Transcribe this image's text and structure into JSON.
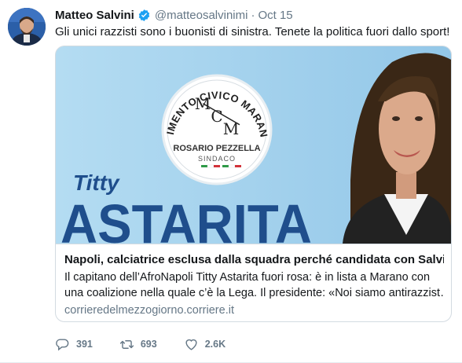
{
  "tweet": {
    "name": "Matteo Salvini",
    "handle": "@matteosalvinimi",
    "separator": "·",
    "date": "Oct 15",
    "text": "Gli unici razzisti sono i buonisti di sinistra. Tenete la politica fuori dallo sport!"
  },
  "card": {
    "image": {
      "logo_arc_text": "MOVIMENTO CIVICO MARANESE",
      "logo_letters": [
        "M",
        "C",
        "M"
      ],
      "logo_name": "ROSARIO PEZZELLA",
      "logo_role": "SINDACO",
      "first_name": "Titty",
      "last_name": "ASTARITA"
    },
    "title": "Napoli, calciatrice esclusa dalla squadra perché candidata con Salvini",
    "description_lines": [
      "Il capitano dell’AfroNapoli Titty Astarita fuori rosa: è in lista a Marano con",
      "una coalizione nella quale c’è la Lega. Il presidente: «Noi siamo antirazzist…"
    ],
    "domain": "corrieredelmezzogiorno.corriere.it"
  },
  "actions": {
    "reply": {
      "icon": "reply-icon",
      "count": "391"
    },
    "retweet": {
      "icon": "retweet-icon",
      "count": "693"
    },
    "like": {
      "icon": "like-icon",
      "count": "2.6K"
    }
  },
  "colors": {
    "text": "#14171a",
    "secondary": "#657786",
    "verified": "#1da1f2",
    "card_border": "#d3dbe1",
    "poster_blue": "#1f4e8c"
  }
}
